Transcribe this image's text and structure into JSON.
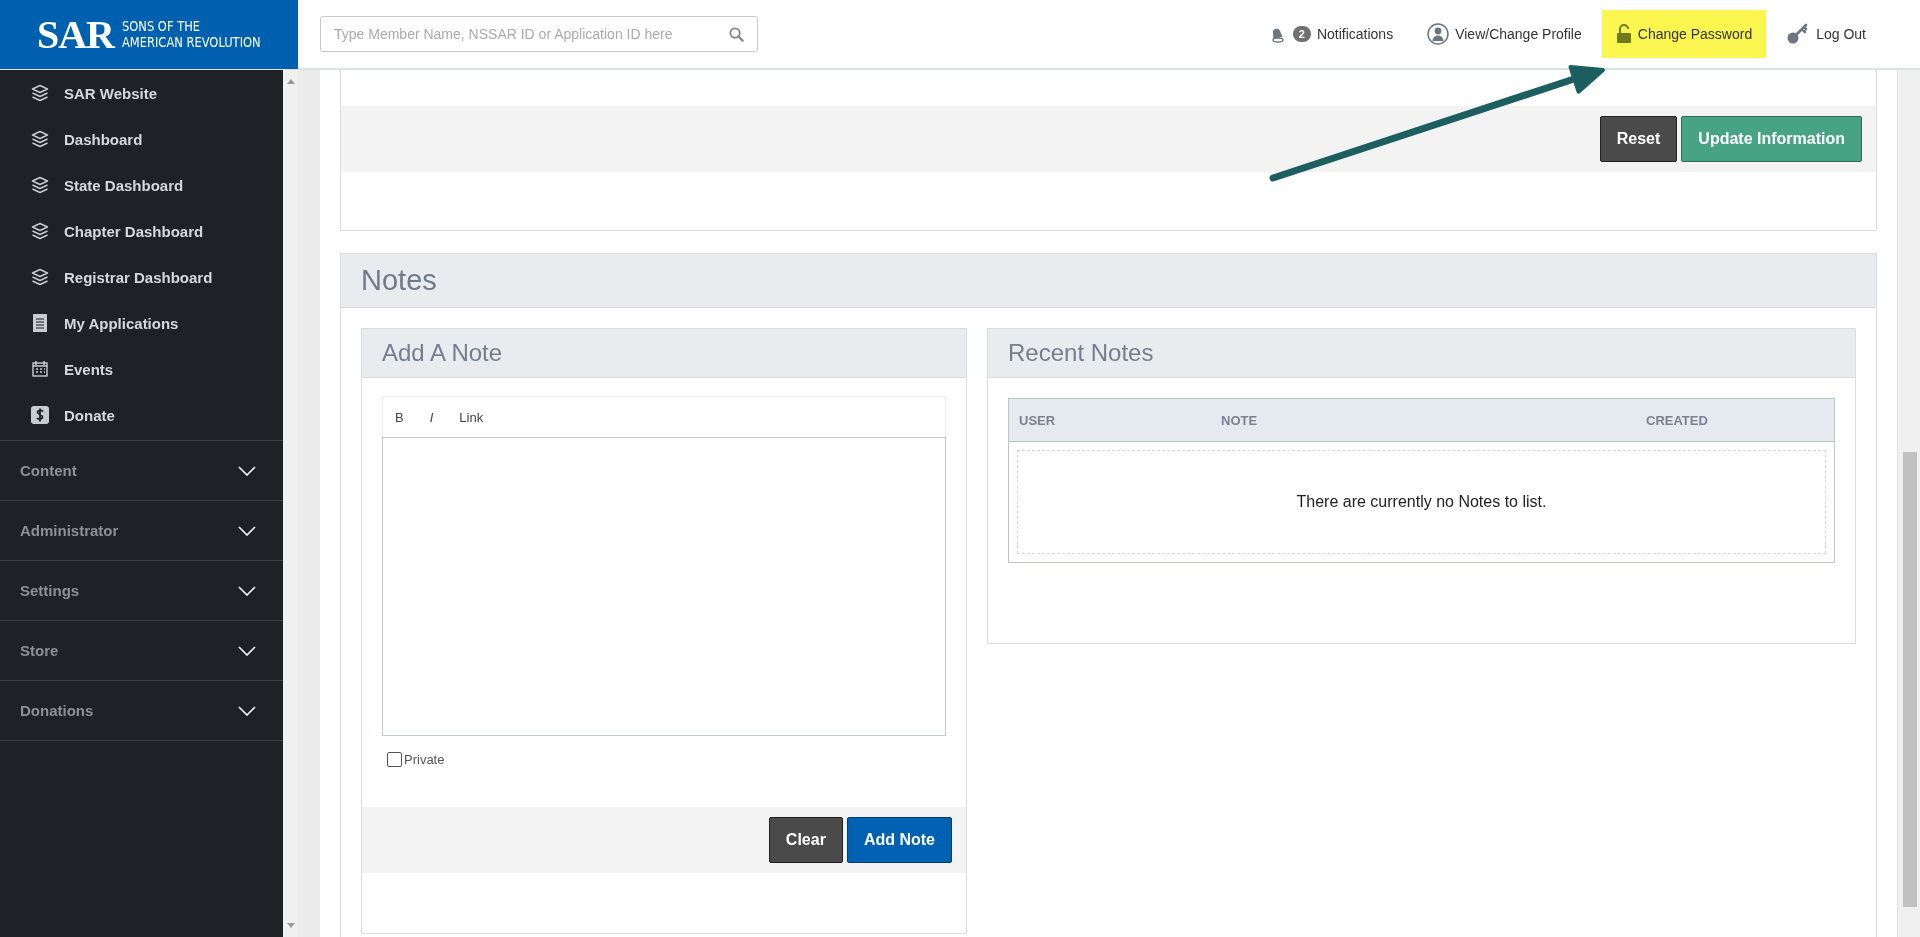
{
  "brand": {
    "mark": "SAR",
    "line1": "SONS OF THE",
    "line2": "AMERICAN REVOLUTION"
  },
  "search": {
    "placeholder": "Type Member Name, NSSAR ID or Application ID here"
  },
  "top_nav": [
    {
      "kind": "notifications",
      "label": "Notifications",
      "badge": "2",
      "highlighted": false
    },
    {
      "kind": "profile",
      "label": "View/Change Profile",
      "highlighted": false
    },
    {
      "kind": "password",
      "label": "Change Password",
      "highlighted": true
    },
    {
      "kind": "logout",
      "label": "Log Out",
      "highlighted": false
    }
  ],
  "sidebar": {
    "links": [
      {
        "kind": "dashboard",
        "label": "SAR Website"
      },
      {
        "kind": "dashboard",
        "label": "Dashboard"
      },
      {
        "kind": "dashboard",
        "label": "State Dashboard"
      },
      {
        "kind": "dashboard",
        "label": "Chapter Dashboard"
      },
      {
        "kind": "dashboard",
        "label": "Registrar Dashboard"
      },
      {
        "kind": "applications",
        "label": "My Applications"
      },
      {
        "kind": "events",
        "label": "Events"
      },
      {
        "kind": "donate",
        "label": "Donate"
      }
    ],
    "sections": [
      {
        "label": "Content",
        "expanded": false
      },
      {
        "label": "Administrator",
        "expanded": false
      },
      {
        "label": "Settings",
        "expanded": false
      },
      {
        "label": "Store",
        "expanded": false
      },
      {
        "label": "Donations",
        "expanded": false
      }
    ]
  },
  "profile_form": {
    "buttons": [
      {
        "kind": "reset",
        "label": "Reset"
      },
      {
        "kind": "update",
        "label": "Update Information"
      }
    ]
  },
  "notes": {
    "title": "Notes",
    "add_note": {
      "title": "Add A Note",
      "toolbar": [
        {
          "kind": "bold",
          "label": "B"
        },
        {
          "kind": "italic",
          "label": "I"
        },
        {
          "kind": "link",
          "label": "Link"
        }
      ],
      "private": {
        "label": "Private",
        "checked": false
      },
      "buttons": [
        {
          "kind": "clear",
          "label": "Clear"
        },
        {
          "kind": "add",
          "label": "Add Note"
        }
      ]
    },
    "recent_notes": {
      "title": "Recent Notes",
      "columns": [
        "USER",
        "NOTE",
        "CREATED"
      ],
      "empty_message": "There are currently no Notes to list."
    }
  }
}
